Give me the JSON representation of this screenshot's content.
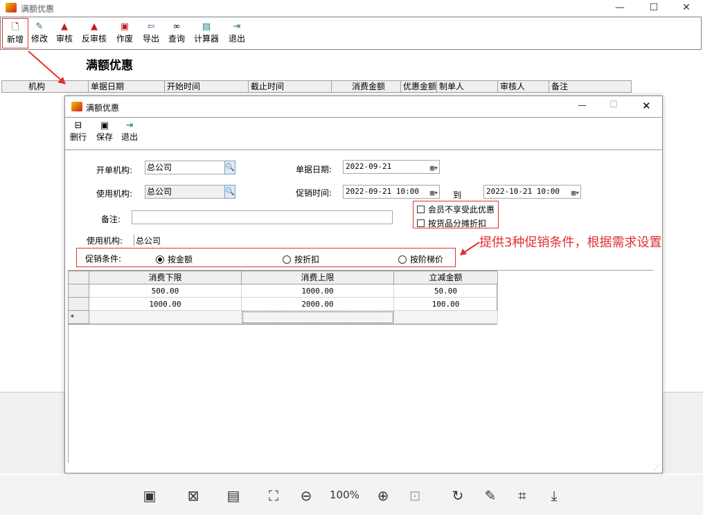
{
  "window": {
    "title": "满额优惠",
    "minimize": "—",
    "maximize": "☐",
    "close": "✕"
  },
  "toolbar": [
    {
      "name": "new",
      "label": "新增",
      "icon": "new-doc-icon"
    },
    {
      "name": "edit",
      "label": "修改",
      "icon": "edit-icon"
    },
    {
      "name": "audit",
      "label": "审核",
      "icon": "stamp-icon"
    },
    {
      "name": "unaudit",
      "label": "反审核",
      "icon": "unstamp-icon"
    },
    {
      "name": "void",
      "label": "作废",
      "icon": "void-icon"
    },
    {
      "name": "export",
      "label": "导出",
      "icon": "export-icon"
    },
    {
      "name": "query",
      "label": "查询",
      "icon": "binoculars-icon"
    },
    {
      "name": "calculator",
      "label": "计算器",
      "icon": "calculator-icon"
    },
    {
      "name": "exit",
      "label": "退出",
      "icon": "exit-icon"
    }
  ],
  "list": {
    "heading": "满额优惠",
    "columns": [
      "机构",
      "单据日期",
      "开始时间",
      "截止时间",
      "消费金额",
      "优惠金额",
      "制单人",
      "审核人",
      "备注"
    ]
  },
  "dialog": {
    "title": "满额优惠",
    "toolbar": [
      {
        "name": "delete-row",
        "label": "删行",
        "icon": "delete-row-icon"
      },
      {
        "name": "save",
        "label": "保存",
        "icon": "save-icon"
      },
      {
        "name": "exit",
        "label": "退出",
        "icon": "exit-icon"
      }
    ],
    "form": {
      "issuing_org_label": "开单机构:",
      "issuing_org": "总公司",
      "doc_date_label": "单据日期:",
      "doc_date": "2022-09-21",
      "use_org_label": "使用机构:",
      "use_org": "总公司",
      "promo_time_label": "促销时间:",
      "promo_start": "2022-09-21 10:00",
      "to_label": "到",
      "promo_end": "2022-10-21 10:00",
      "member_excluded": "会员不享受此优惠",
      "member_excluded_checked": false,
      "split_discount": "按货品分摊折扣",
      "split_discount_checked": false,
      "remark_label": "备注:",
      "remark": "",
      "use_org_label2": "使用机构:",
      "use_org2": "总公司",
      "condition_label": "促销条件:",
      "conditions": [
        {
          "label": "按金额",
          "selected": true
        },
        {
          "label": "按折扣",
          "selected": false
        },
        {
          "label": "按阶梯价",
          "selected": false
        }
      ]
    },
    "grid": {
      "columns": [
        "消费下限",
        "消费上限",
        "立减金额"
      ],
      "rows": [
        [
          "500.00",
          "1000.00",
          "50.00"
        ],
        [
          "1000.00",
          "2000.00",
          "100.00"
        ]
      ],
      "new_row_marker": "*"
    }
  },
  "annotation": "提供3种促销条件，根据需求设置",
  "viewer": {
    "zoom": "100%"
  },
  "colors": {
    "annotation_red": "#e03030",
    "grid_header": "#efefef"
  }
}
